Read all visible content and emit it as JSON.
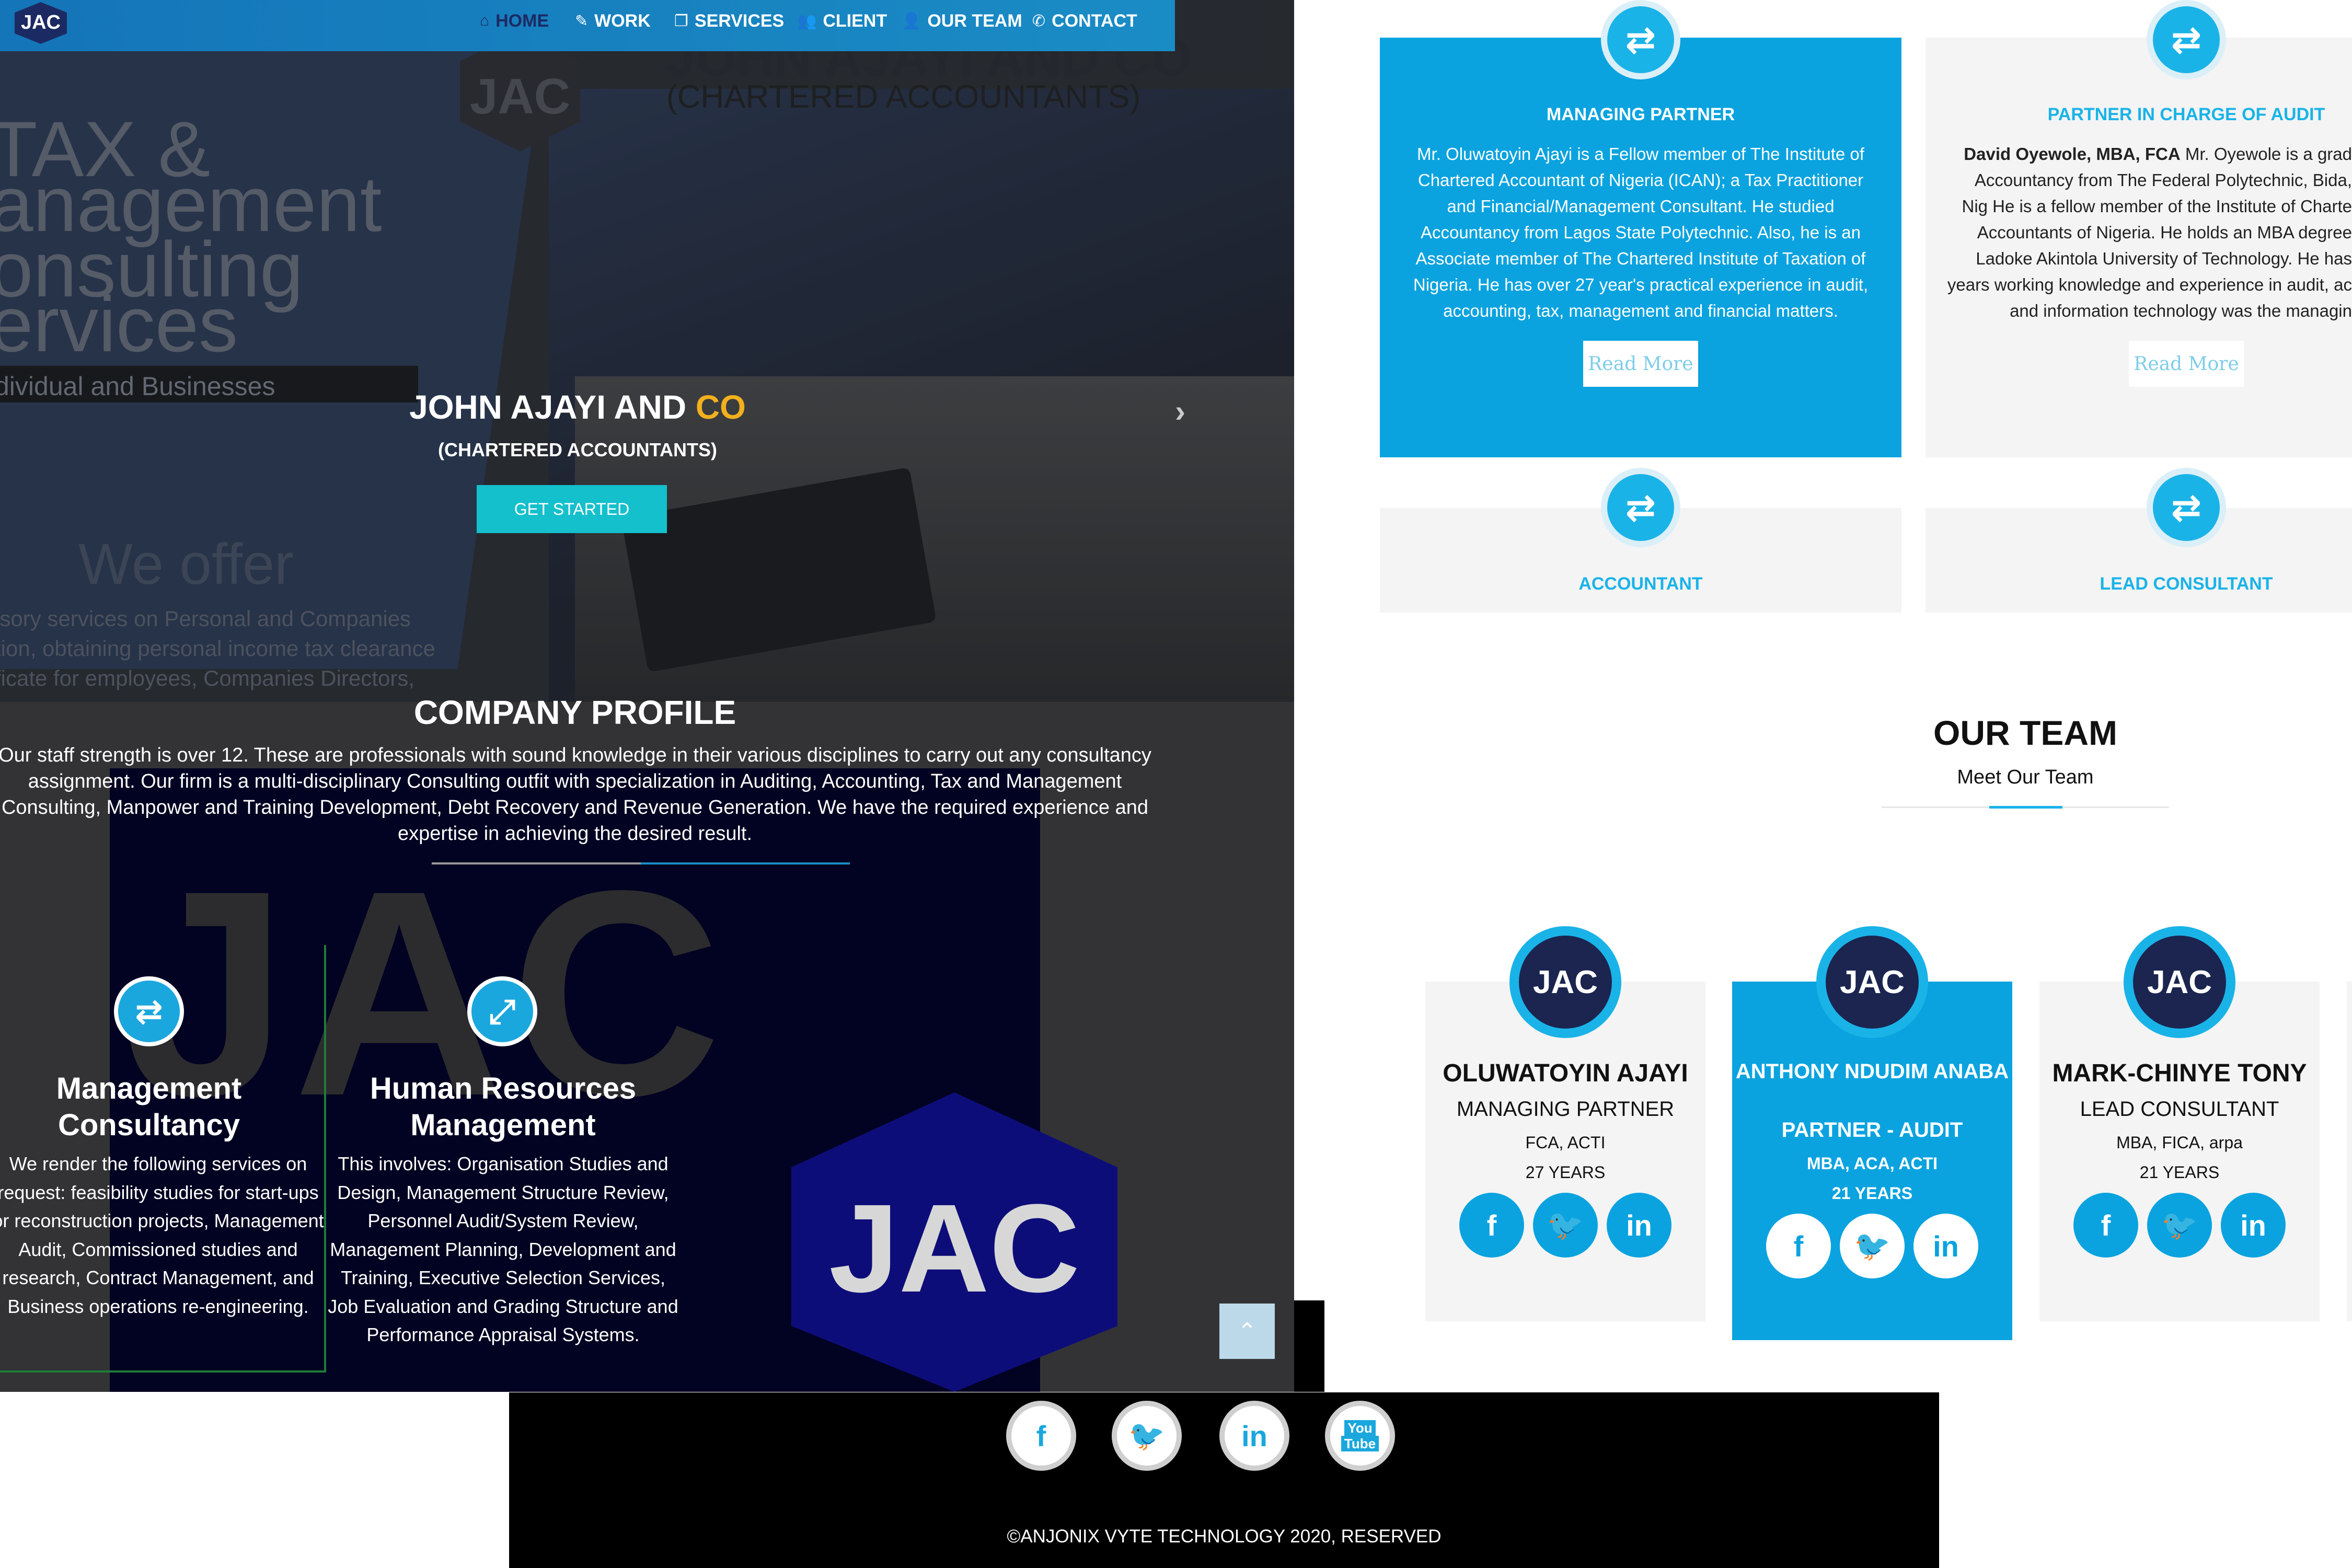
{
  "nav": {
    "brand": "JAC",
    "items": [
      {
        "label": "HOME",
        "icon": "home-icon",
        "glyph": "⌂"
      },
      {
        "label": "WORK",
        "icon": "edit-icon",
        "glyph": "✎"
      },
      {
        "label": "SERVICES",
        "icon": "copy-icon",
        "glyph": "❐"
      },
      {
        "label": "CLIENT",
        "icon": "users-icon",
        "glyph": "👥"
      },
      {
        "label": "OUR TEAM",
        "icon": "user-icon",
        "glyph": "👤"
      },
      {
        "label": "CONTACT",
        "icon": "phone-icon",
        "glyph": "✆"
      }
    ]
  },
  "hero": {
    "bg_text": {
      "firm_line1": "JOHN AJAYI AND CO",
      "firm_line2": "(CHARTERED ACCOUNTANTS)",
      "logo": "JAC",
      "tax": "TAX &",
      "management": "anagement",
      "consulting": "onsulting",
      "services": "ervices",
      "individual": "dividual and Businesses",
      "we_offer": "We offer",
      "offer_1": "isory services on Personal  and Companies",
      "offer_2": "tion, obtaining personal income tax clearance",
      "offer_3": "ficate for employees, Companies Directors,"
    },
    "title_main": "JOHN AJAYI AND ",
    "title_accent": "CO",
    "subtitle": "(CHARTERED ACCOUNTANTS)",
    "cta": "GET STARTED",
    "next": "›"
  },
  "profile": {
    "title": "COMPANY PROFILE",
    "text": "Our staff strength is over 12. These are professionals with sound knowledge in their various disciplines to carry out any consultancy assignment. Our firm is a multi-disciplinary Consulting outfit with specialization in Auditing, Accounting, Tax and Management Consulting, Manpower and Training Development, Debt Recovery and Revenue Generation. We have the required experience and expertise in achieving the desired result.",
    "bg_letters": "JAC",
    "logo_text": "JAC"
  },
  "services": [
    {
      "icon": "exchange-icon",
      "glyph": "⇄",
      "title": "Management Consultancy",
      "text": "We render the following services on request: feasibility studies for start-ups or reconstruction projects, Management Audit, Commissioned studies and research, Contract Management, and Business operations re-engineering."
    },
    {
      "icon": "expand-icon",
      "glyph": "⤢",
      "title": "Human Resources Management",
      "text": "This involves: Organisation Studies and Design, Management Structure Review, Personnel Audit/System Review, Management Planning, Development and Training, Executive Selection Services, Job Evaluation and Grading Structure and Performance Appraisal Systems."
    }
  ],
  "scroll_top": "⌃",
  "partners": [
    {
      "title": "MANAGING PARTNER",
      "body": "Mr. Oluwatoyin Ajayi is a Fellow member of The Institute of Chartered Accountant of Nigeria (ICAN); a Tax Practitioner and Financial/Management Consultant. He studied Accountancy from Lagos State Polytechnic. Also, he is an Associate member of The Chartered Institute of Taxation of Nigeria. He has over 27 year's practical experience in audit, accounting, tax, management and financial matters.",
      "read_more": "Read More"
    },
    {
      "title": "PARTNER IN CHARGE OF AUDIT",
      "body_bold": "David Oyewole, MBA, FCA",
      "body": " Mr. Oyewole is a grad Accountancy from The Federal Polytechnic, Bida, Nig He is a fellow member of the Institute of Charte Accountants of Nigeria. He holds an MBA degree Ladoke Akintola University of Technology. He has years working knowledge and experience in audit, ac and information technology was the managin",
      "read_more": "Read More"
    },
    {
      "title": "ACCOUNTANT"
    },
    {
      "title": "LEAD CONSULTANT"
    }
  ],
  "team": {
    "title": "OUR TEAM",
    "subtitle": "Meet Our Team",
    "members": [
      {
        "avatar": "JAC",
        "name": "OLUWATOYIN AJAYI",
        "role": "MANAGING PARTNER",
        "quals": "FCA, ACTI",
        "years": "27 YEARS"
      },
      {
        "avatar": "JAC",
        "name": "ANTHONY NDUDIM ANABA",
        "role": "PARTNER - AUDIT",
        "quals": "MBA, ACA, ACTI",
        "years": "21 YEARS"
      },
      {
        "avatar": "JAC",
        "name": "MARK-CHINYE TONY",
        "role": "LEAD CONSULTANT",
        "quals": "MBA, FICA, arpa",
        "years": "21 YEARS"
      }
    ]
  },
  "social": {
    "facebook": "f",
    "twitter": "🐦",
    "linkedin": "in",
    "youtube_line1": "You",
    "youtube_line2": "Tube"
  },
  "footer": {
    "copyright": "©ANJONIX VYTE TECHNOLOGY 2020, RESERVED"
  },
  "colors": {
    "accent": "#0aa3df",
    "nav": "#1a8cc5",
    "gold": "#f2b01e",
    "cta": "#14c0cc"
  }
}
